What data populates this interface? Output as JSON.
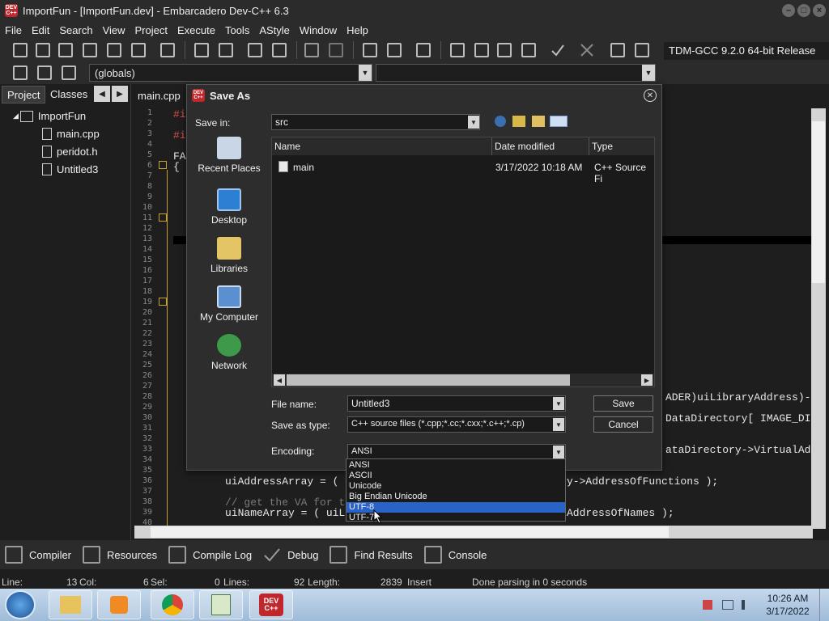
{
  "window": {
    "title": "ImportFun - [ImportFun.dev] - Embarcadero Dev-C++ 6.3",
    "app_icon_text": "DEV C++"
  },
  "menu": [
    "File",
    "Edit",
    "Search",
    "View",
    "Project",
    "Execute",
    "Tools",
    "AStyle",
    "Window",
    "Help"
  ],
  "toolbar": {
    "compiler": "TDM-GCC 9.2.0 64-bit Release",
    "scope": "(globals)"
  },
  "left_panel": {
    "tabs": [
      "Project",
      "Classes"
    ],
    "tree": {
      "project": "ImportFun",
      "files": [
        "main.cpp",
        "peridot.h",
        "Untitled3"
      ]
    }
  },
  "editor": {
    "tab": "main.cpp",
    "line_numbers": [
      "1",
      "2",
      "3",
      "4",
      "5",
      "6",
      "7",
      "8",
      "9",
      "10",
      "11",
      "12",
      "13",
      "14",
      "15",
      "16",
      "17",
      "18",
      "19",
      "20",
      "21",
      "22",
      "23",
      "24",
      "25",
      "26",
      "27",
      "28",
      "29",
      "30",
      "31",
      "32",
      "33",
      "34",
      "35",
      "36",
      "37",
      "38",
      "39",
      "40"
    ],
    "visible_code": {
      "l2": "#i",
      "l3": "#i",
      "l5": "FA",
      "l6": "{",
      "l28": "ADER)uiLibraryAddress)->",
      "l30": "DataDirectory[ IMAGE_DI",
      "l33": "ataDirectory->VirtualAdd",
      "l36a": "uiAddressArray = (",
      "l36b": "y->AddressOfFunctions );",
      "l38": "// get the VA for t",
      "l39a": "uiNameArray = ( uiL",
      "l39b": "AddressOfNames );"
    }
  },
  "dialog": {
    "title": "Save As",
    "save_in_label": "Save in:",
    "save_in_value": "src",
    "places": [
      "Recent Places",
      "Desktop",
      "Libraries",
      "My Computer",
      "Network"
    ],
    "columns": [
      "Name",
      "Date modified",
      "Type"
    ],
    "files": [
      {
        "name": "main",
        "date": "3/17/2022 10:18 AM",
        "type": "C++ Source Fi"
      }
    ],
    "file_name_label": "File name:",
    "file_name_value": "Untitled3",
    "save_as_type_label": "Save as type:",
    "save_as_type_value": "C++ source files (*.cpp;*.cc;*.cxx;*.c++;*.cp)",
    "encoding_label": "Encoding:",
    "encoding_value": "ANSI",
    "encoding_options": [
      "ANSI",
      "ASCII",
      "Unicode",
      "Big Endian Unicode",
      "UTF-8",
      "UTF-7"
    ],
    "encoding_highlighted": "UTF-8",
    "save_button": "Save",
    "cancel_button": "Cancel"
  },
  "bottom_tabs": [
    "Compiler",
    "Resources",
    "Compile Log",
    "Debug",
    "Find Results",
    "Console"
  ],
  "status": {
    "line": "Line:",
    "line_val": "13",
    "col": "Col:",
    "col_val": "6",
    "sel": "Sel:",
    "sel_val": "0",
    "lines": "Lines:",
    "lines_val": "92",
    "length": "Length:",
    "length_val": "2839",
    "mode": "Insert",
    "message": "Done parsing in 0 seconds"
  },
  "taskbar": {
    "time": "10:26 AM",
    "date": "3/17/2022"
  },
  "colors": {
    "selection": "#2a63c8",
    "keyword": "#e05050",
    "fold_marker": "#c9a227"
  }
}
